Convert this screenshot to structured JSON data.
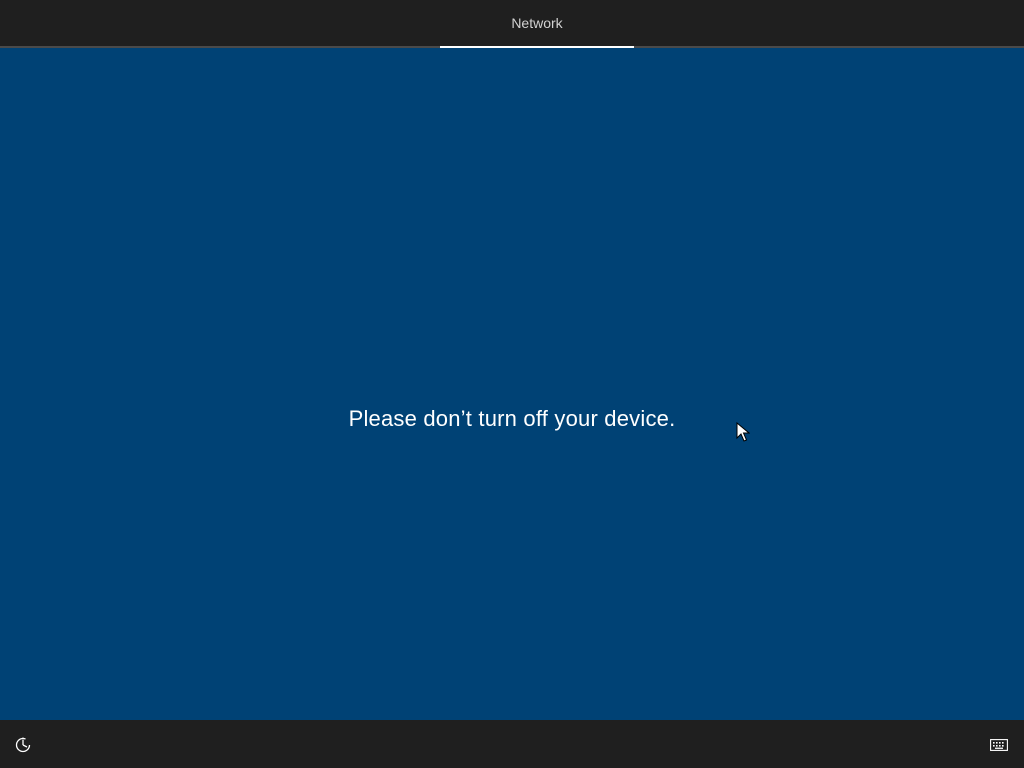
{
  "header": {
    "tabs": [
      {
        "label": "Network",
        "active": true
      }
    ]
  },
  "main": {
    "message": "Please don’t turn off your device."
  },
  "footer": {
    "left_icon": "ease-of-access-icon",
    "right_icon": "keyboard-icon"
  },
  "colors": {
    "background": "#004275",
    "bars": "#1f1f1f",
    "text": "#ffffff",
    "tab_text": "#d2d2d2"
  }
}
